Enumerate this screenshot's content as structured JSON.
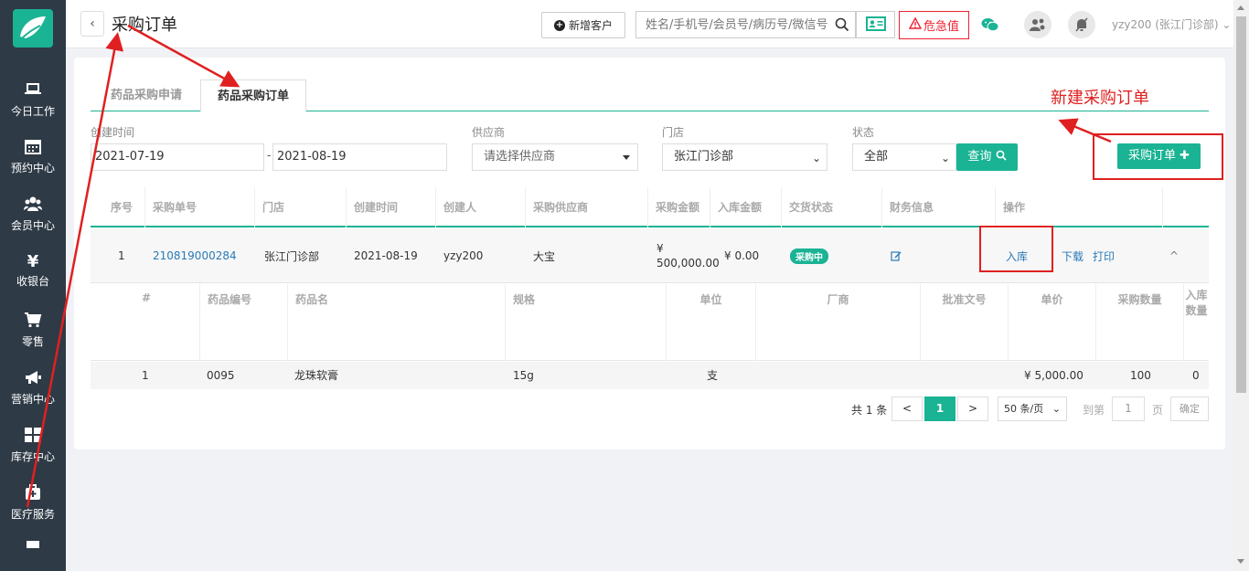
{
  "sidebar": {
    "items": [
      {
        "label": "今日工作",
        "icon": "laptop-icon"
      },
      {
        "label": "预约中心",
        "icon": "calendar-icon"
      },
      {
        "label": "会员中心",
        "icon": "users-icon"
      },
      {
        "label": "收银台",
        "icon": "yen-icon",
        "glyph": "¥"
      },
      {
        "label": "零售",
        "icon": "cart-icon"
      },
      {
        "label": "营销中心",
        "icon": "megaphone-icon"
      },
      {
        "label": "库存中心",
        "icon": "grid-icon"
      },
      {
        "label": "医疗服务",
        "icon": "medkit-icon"
      }
    ]
  },
  "header": {
    "back_label": "‹",
    "title": "采购订单",
    "new_customer_label": "新增客户",
    "search_placeholder": "姓名/手机号/会员号/病历号/微信号",
    "danger_label": "危急值",
    "user_label": "yzy200 (张江门诊部)"
  },
  "tabs": [
    {
      "label": "药品采购申请",
      "active": false
    },
    {
      "label": "药品采购订单",
      "active": true
    }
  ],
  "annotation": {
    "new_order_text": "新建采购订单"
  },
  "filters": {
    "created_label": "创建时间",
    "start_date": "2021-07-19",
    "end_date": "2021-08-19",
    "supplier_label": "供应商",
    "supplier_placeholder": "请选择供应商",
    "store_label": "门店",
    "store_value": "张江门诊部",
    "status_label": "状态",
    "status_value": "全部",
    "query_label": "查询",
    "po_button_label": "采购订单"
  },
  "table": {
    "headers": [
      "序号",
      "采购单号",
      "门店",
      "创建时间",
      "创建人",
      "采购供应商",
      "采购金额",
      "入库金额",
      "交货状态",
      "财务信息",
      "操作"
    ],
    "rows": [
      {
        "index": "1",
        "order_no": "210819000284",
        "store": "张江门诊部",
        "created": "2021-08-19",
        "creator": "yzy200",
        "supplier": "大宝",
        "amount_symbol": "¥",
        "amount": "500,000.00",
        "stock_amount": "¥ 0.00",
        "status": "采购中",
        "actions": {
          "stock_in": "入库",
          "download": "下载",
          "print": "打印"
        }
      }
    ]
  },
  "subtable": {
    "headers": [
      "#",
      "药品编号",
      "药品名",
      "规格",
      "单位",
      "厂商",
      "批准文号",
      "单价",
      "采购数量",
      "入库数量"
    ],
    "rows": [
      {
        "index": "1",
        "code": "0095",
        "name": "龙珠软膏",
        "spec": "15g",
        "unit": "支",
        "maker": "",
        "approval": "",
        "price": "¥ 5,000.00",
        "qty": "100",
        "stock_qty": "0"
      }
    ]
  },
  "pagination": {
    "total": "共 1 条",
    "prev": "<",
    "current": "1",
    "next": ">",
    "page_size": "50 条/页",
    "goto_label": "到第",
    "goto_value": "1",
    "page_label": "页",
    "confirm": "确定"
  }
}
